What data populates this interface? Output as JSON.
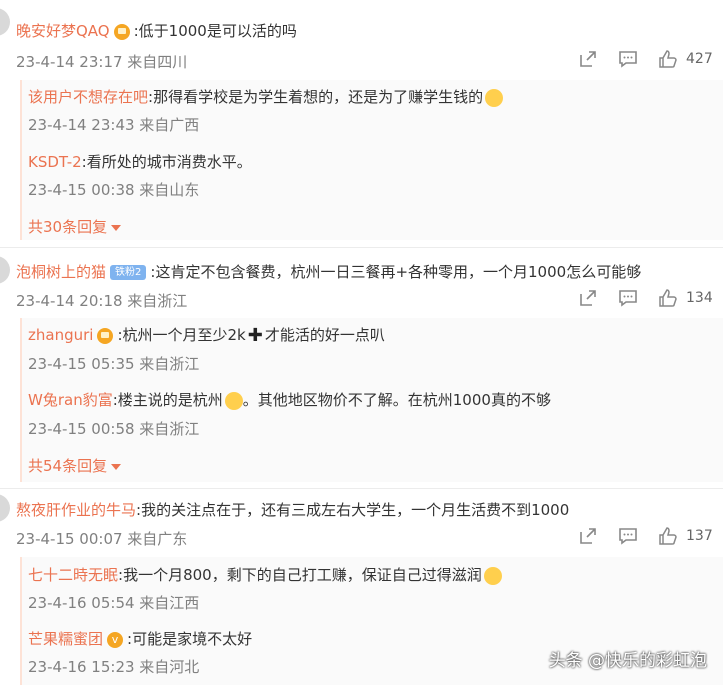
{
  "comments": [
    {
      "user": "晚安好梦QAQ",
      "text": ":低于1000是可以活的吗",
      "time": "23-4-14 23:17 来自四川",
      "likes": "427",
      "replies": [
        {
          "user": "该用户不想存在吧",
          "text": ":那得看学校是为学生着想的，还是为了赚学生钱的",
          "time": "23-4-14 23:43 来自广西"
        },
        {
          "user": "KSDT-2",
          "text": ":看所处的城市消费水平。",
          "time": "23-4-15 00:38 来自山东"
        }
      ],
      "more": "共30条回复"
    },
    {
      "user": "泡桐树上的猫",
      "badge": "铁粉2",
      "text": ":这肯定不包含餐费，杭州一日三餐再+各种零用，一个月1000怎么可能够",
      "time": "23-4-14 20:18 来自浙江",
      "likes": "134",
      "replies": [
        {
          "user": "zhanguri",
          "text_a": ":杭州一个月至少2k",
          "text_b": "才能活的好一点叭",
          "time": "23-4-15 05:35 来自浙江"
        },
        {
          "user": "W兔ran豹富",
          "text_a": ":楼主说的是杭州",
          "text_b": "。其他地区物价不了解。在杭州1000真的不够",
          "time": "23-4-15 00:58 来自浙江"
        }
      ],
      "more": "共54条回复"
    },
    {
      "user": "熬夜肝作业的牛马",
      "text": ":我的关注点在于，还有三成左右大学生，一个月生活费不到1000",
      "time": "23-4-15 00:07 来自广东",
      "likes": "137",
      "replies": [
        {
          "user": "七十二時无眠",
          "text": ":我一个月800，剩下的自己打工赚，保证自己过得滋润",
          "time": "23-4-16 05:54 来自江西"
        },
        {
          "user": "芒果糯蜜团",
          "text": ":可能是家境不太好",
          "time": "23-4-16 15:23 来自河北"
        }
      ]
    }
  ],
  "watermark": "头条 @快乐的彩虹泡",
  "colors": {
    "username": "#eb7350",
    "meta": "#808080",
    "text": "#333333"
  }
}
